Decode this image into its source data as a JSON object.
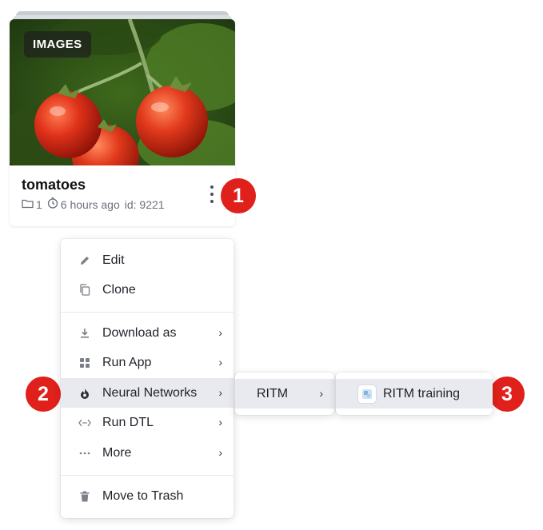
{
  "card": {
    "badge": "IMAGES",
    "title": "tomatoes",
    "folder_icon": "folder-icon",
    "items_count": "1",
    "clock_icon": "clock-icon",
    "updated": "6 hours ago",
    "id_text": "id: 9221",
    "more_icon": "kebab-icon"
  },
  "markers": [
    "1",
    "2",
    "3"
  ],
  "menu": {
    "items": [
      {
        "label": "Edit",
        "icon": "pencil-icon"
      },
      {
        "label": "Clone",
        "icon": "copy-icon"
      },
      {
        "label": "Download as",
        "icon": "download-icon",
        "submenu": true
      },
      {
        "label": "Run App",
        "icon": "apps-grid-icon",
        "submenu": true
      },
      {
        "label": "Neural Networks",
        "icon": "flame-icon",
        "submenu": true,
        "active": true
      },
      {
        "label": "Run DTL",
        "icon": "code-arrows-icon",
        "submenu": true
      },
      {
        "label": "More",
        "icon": "ellipsis-icon",
        "submenu": true
      },
      {
        "label": "Move to Trash",
        "icon": "trash-icon"
      }
    ],
    "chevron": "›"
  },
  "submenu": {
    "label": "RITM",
    "chevron": "›"
  },
  "submenu2": {
    "label": "RITM training",
    "icon": "app-thumbnail-icon"
  },
  "colors": {
    "marker": "#e0201b",
    "active_row": "#e8eaef",
    "badge_bg": "#1e201e"
  }
}
